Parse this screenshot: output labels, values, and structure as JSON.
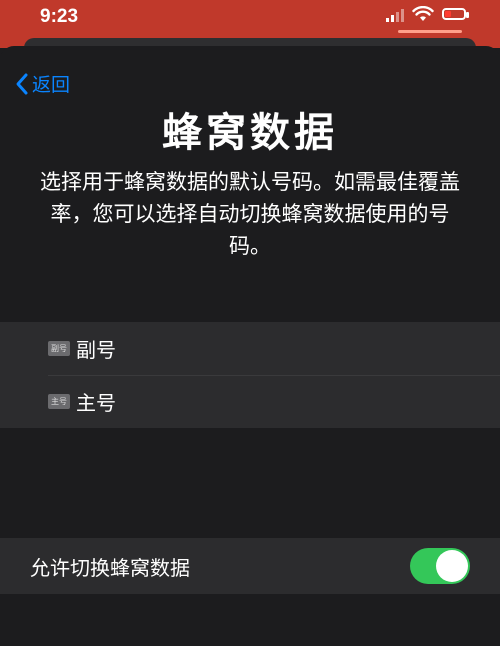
{
  "status_bar": {
    "time": "9:23",
    "icons": [
      "cellular-signal-icon",
      "wifi-icon",
      "battery-low-icon"
    ],
    "background": "#c0392b"
  },
  "nav": {
    "back_label": "返回",
    "back_icon": "chevron-left-icon",
    "accent": "#0a84ff"
  },
  "page": {
    "title": "蜂窝数据",
    "description": "选择用于蜂窝数据的默认号码。如需最佳覆盖率，您可以选择自动切换蜂窝数据使用的号码。"
  },
  "lines": [
    {
      "badge": "副号",
      "label": "副号"
    },
    {
      "badge": "主号",
      "label": "主号"
    }
  ],
  "allow_switching": {
    "label": "允许切换蜂窝数据",
    "enabled": true,
    "toggle_color": "#34c759"
  }
}
